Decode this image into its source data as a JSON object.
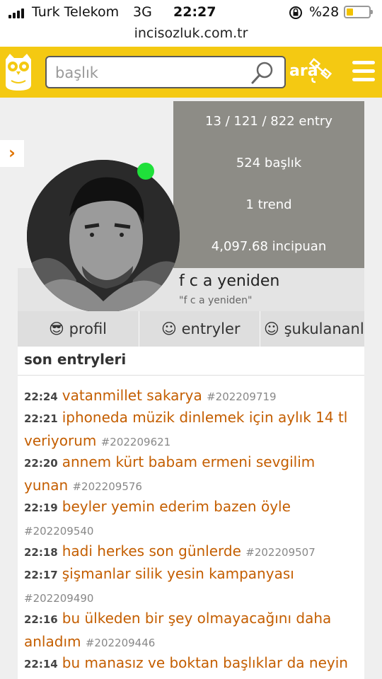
{
  "status_bar": {
    "carrier": "Turk Telekom",
    "network": "3G",
    "time": "22:27",
    "battery": "%28",
    "battery_level": 0.28
  },
  "browser": {
    "url": "incisozluk.com.tr"
  },
  "header": {
    "search_placeholder": "başlık",
    "search_button": "ara",
    "accent_color": "#f4c912"
  },
  "profile": {
    "stats": [
      "13 / 121 / 822 entry",
      "524 başlık",
      "1 trend",
      "4,097.68 incipuan"
    ],
    "username": "f c a yeniden",
    "quote": "\"f c a yeniden\"",
    "online": true
  },
  "tabs": [
    {
      "icon": "😎",
      "label": "profil"
    },
    {
      "icon": "☺",
      "label": "entryler"
    },
    {
      "icon": "☺",
      "label": "şukulananlar"
    }
  ],
  "entries_section": {
    "title": "son entryleri",
    "entries": [
      {
        "time": "22:24",
        "title": "vatanmillet sakarya",
        "id": "#202209719"
      },
      {
        "time": "22:21",
        "title": "iphoneda müzik dinlemek için aylık 14 tl veriyorum",
        "id": "#202209621"
      },
      {
        "time": "22:20",
        "title": "annem kürt babam ermeni sevgilim yunan",
        "id": "#202209576"
      },
      {
        "time": "22:19",
        "title": "beyler yemin ederim bazen öyle",
        "id": "#202209540"
      },
      {
        "time": "22:18",
        "title": "hadi herkes son günlerde",
        "id": "#202209507"
      },
      {
        "time": "22:17",
        "title": "şişmanlar silik yesin kampanyası",
        "id": "#202209490"
      },
      {
        "time": "22:16",
        "title": "bu ülkeden bir şey olmayacağını daha anladım",
        "id": "#202209446"
      },
      {
        "time": "22:14",
        "title": "bu manasız ve boktan başlıklar da neyin",
        "id": ""
      }
    ]
  }
}
